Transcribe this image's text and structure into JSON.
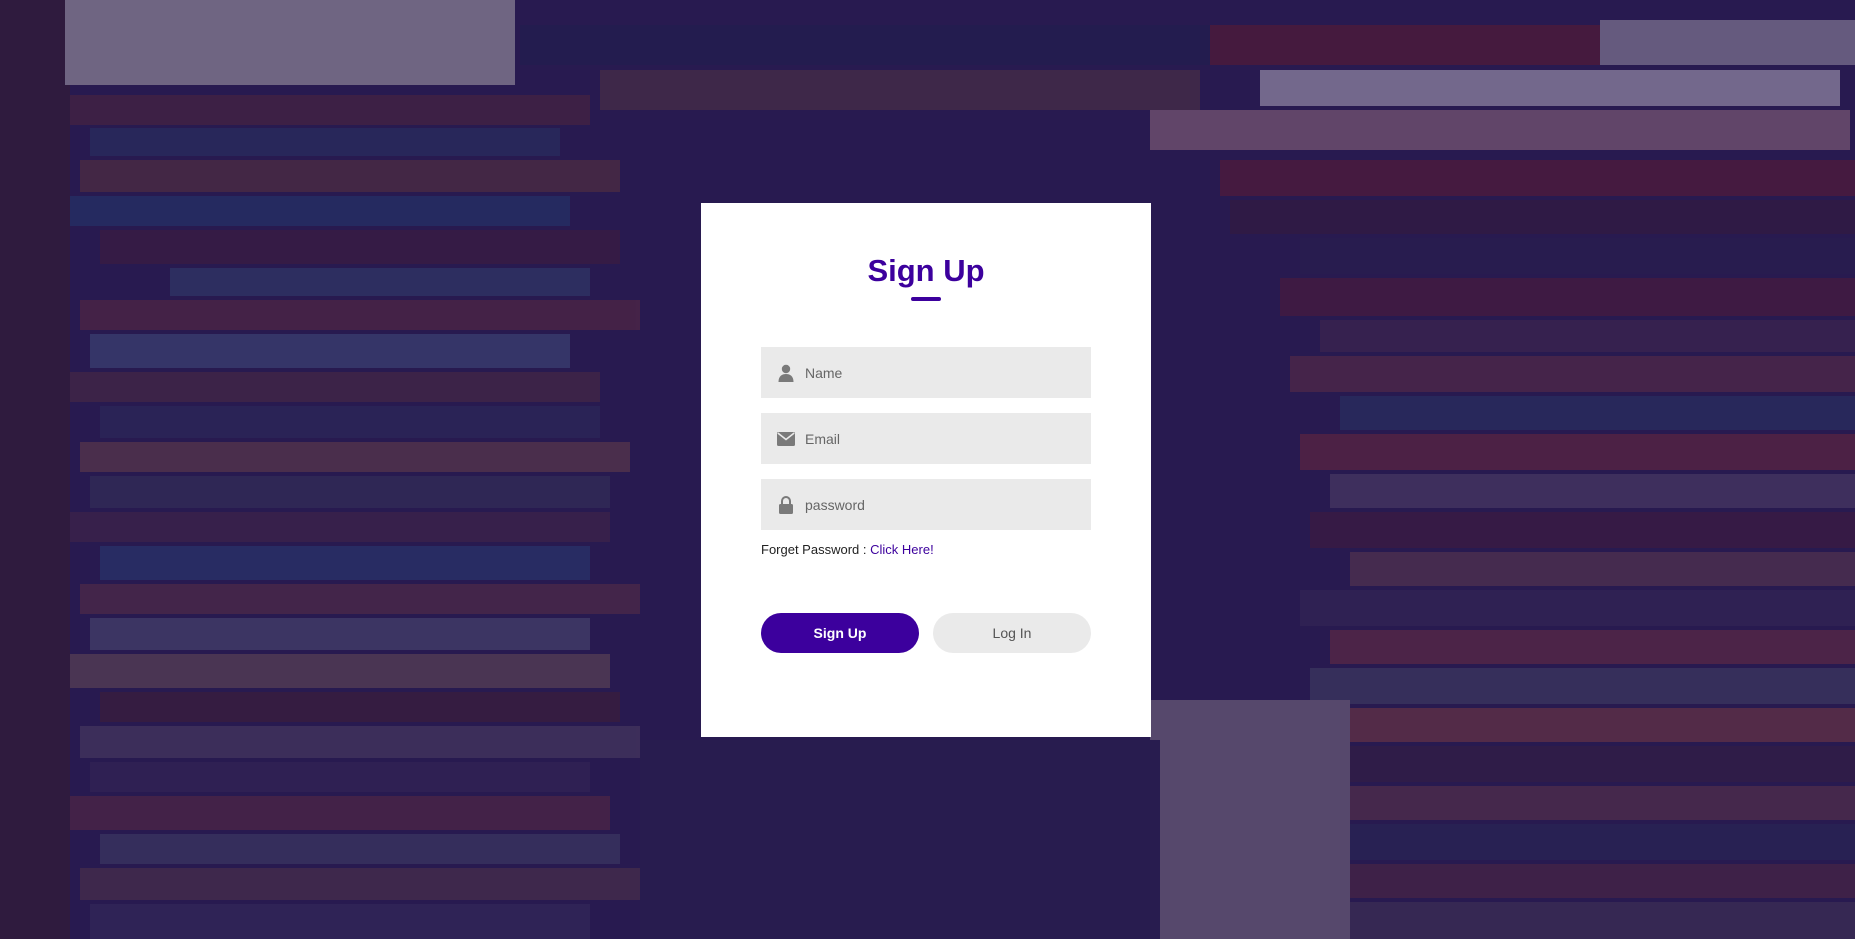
{
  "colors": {
    "accent": "#3c009d",
    "field_background": "#eaeaea",
    "overlay": "#1a0c4e"
  },
  "background": {
    "description_icon": "bookshelf-photo"
  },
  "form": {
    "title": "Sign Up",
    "fields": [
      {
        "icon": "user-icon",
        "placeholder": "Name",
        "value": ""
      },
      {
        "icon": "envelope-icon",
        "placeholder": "Email",
        "value": ""
      },
      {
        "icon": "lock-icon",
        "placeholder": "password",
        "value": ""
      }
    ],
    "forgot": {
      "text": "Forget Password : ",
      "link": "Click Here!"
    },
    "buttons": {
      "signup": "Sign Up",
      "login": "Log In"
    }
  }
}
